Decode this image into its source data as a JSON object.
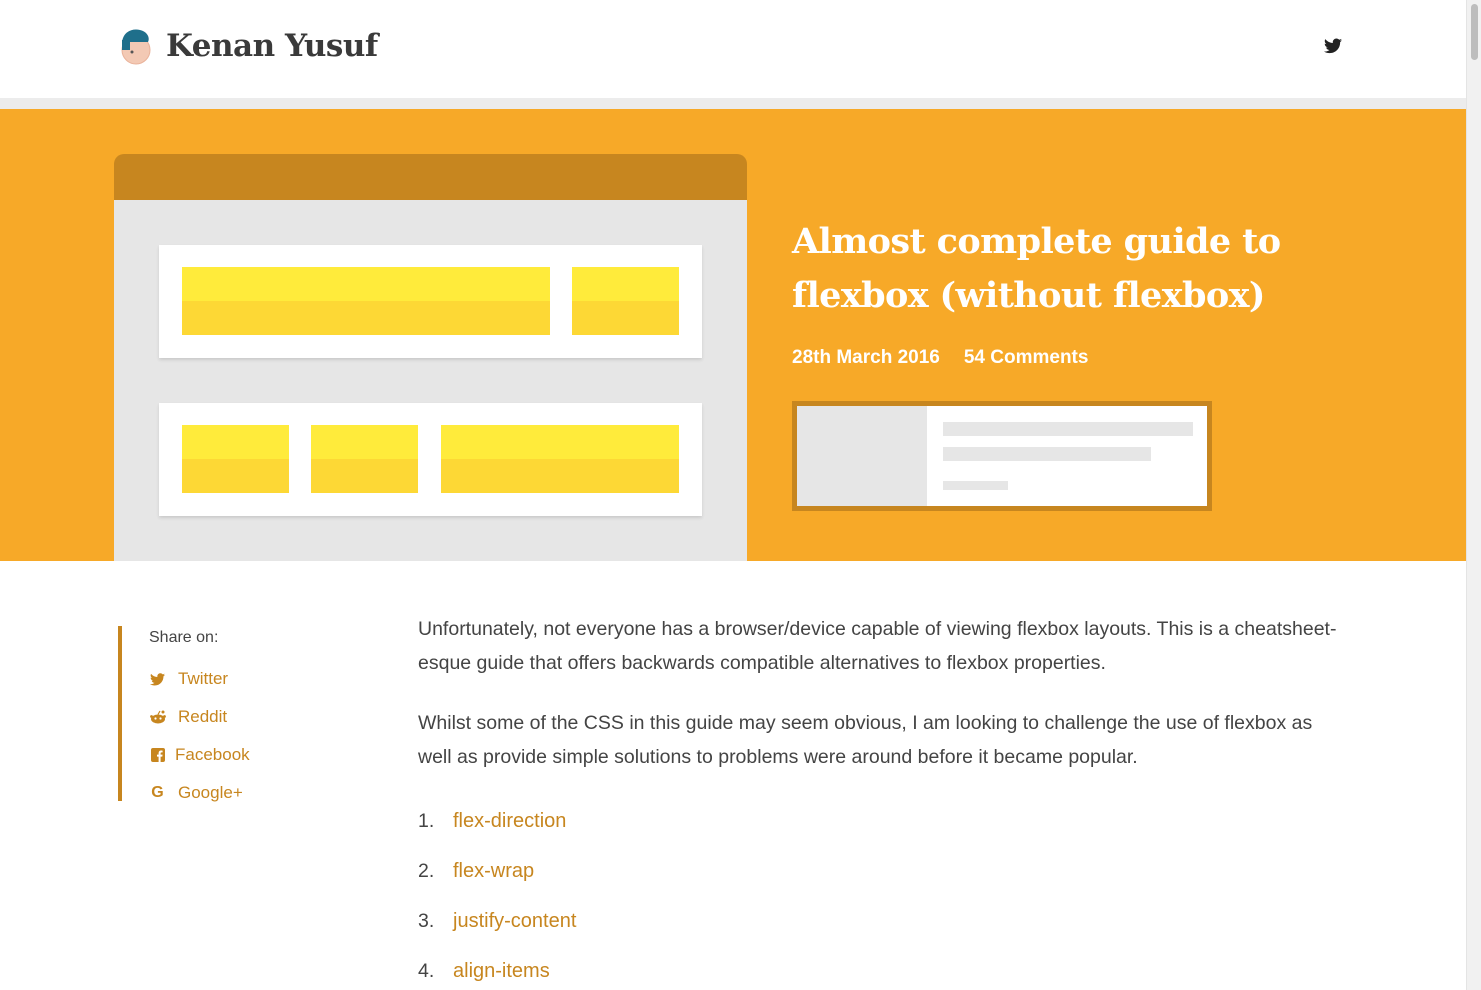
{
  "header": {
    "brand_name": "Kenan Yusuf",
    "avatar_icon": "avatar-icon",
    "twitter_icon": "twitter-icon"
  },
  "hero": {
    "title": "Almost complete guide to flexbox (without flexbox)",
    "date": "28th March 2016",
    "comments": "54 Comments",
    "background_color": "#f7a928",
    "accent_color": "#c7861f"
  },
  "share": {
    "title": "Share on:",
    "items": [
      {
        "label": "Twitter",
        "icon": "twitter-icon"
      },
      {
        "label": "Reddit",
        "icon": "reddit-icon"
      },
      {
        "label": "Facebook",
        "icon": "facebook-icon"
      },
      {
        "label": "Google+",
        "icon": "google-plus-icon"
      }
    ]
  },
  "article": {
    "paragraphs": [
      "Unfortunately, not everyone has a browser/device capable of viewing flexbox layouts. This is a cheatsheet-esque guide that offers backwards compatible alternatives to flexbox properties.",
      "Whilst some of the CSS in this guide may seem obvious, I am looking to challenge the use of flexbox as well as provide simple solutions to problems were around before it became popular."
    ],
    "toc": [
      {
        "num": "1.",
        "label": "flex-direction"
      },
      {
        "num": "2.",
        "label": "flex-wrap"
      },
      {
        "num": "3.",
        "label": "justify-content"
      },
      {
        "num": "4.",
        "label": "align-items"
      }
    ]
  }
}
